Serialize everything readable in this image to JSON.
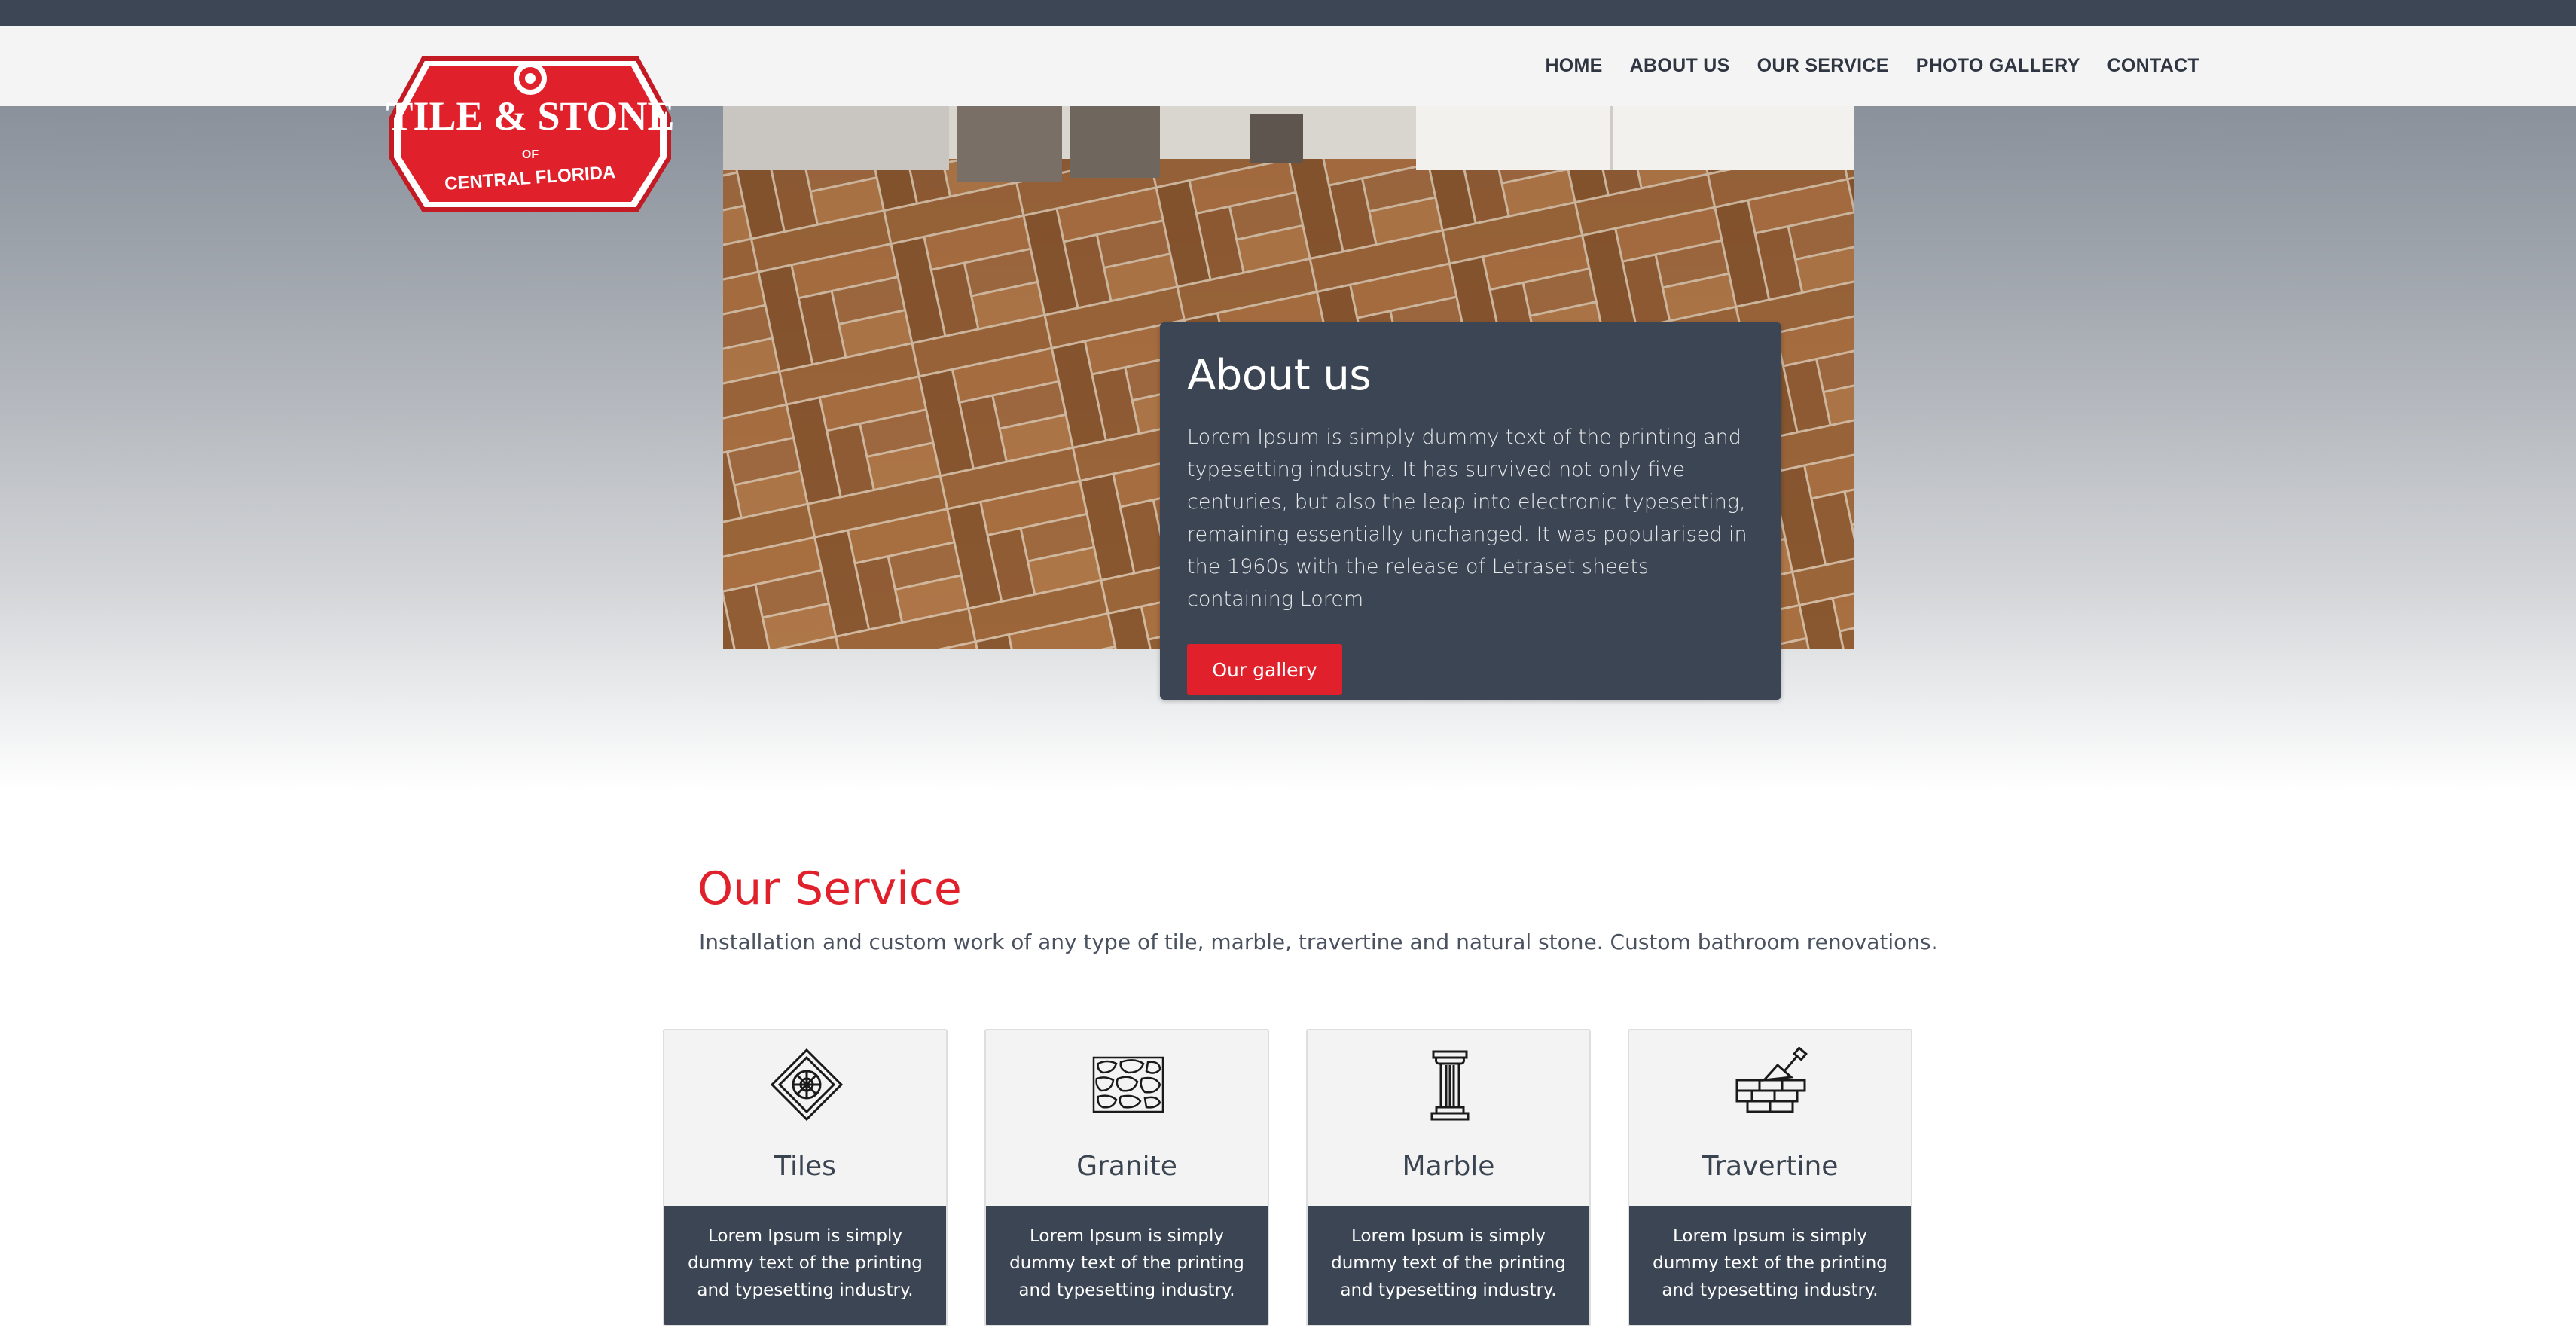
{
  "nav": {
    "items": [
      "HOME",
      "ABOUT US",
      "OUR SERVICE",
      "PHOTO GALLERY",
      "CONTACT"
    ]
  },
  "logo": {
    "line1": "TILE & STONE",
    "line2": "OF",
    "line3": "CENTRAL FLORIDA"
  },
  "about": {
    "title": "About us",
    "text": "Lorem Ipsum is simply dummy text of the printing and typesetting industry. It has survived not only five centuries, but also the leap into electronic typesetting, remaining essentially unchanged. It was popularised in the 1960s with the release of Letraset sheets containing Lorem",
    "button": "Our gallery"
  },
  "service": {
    "title": "Our Service",
    "subtitle": "Installation and custom work of any type of tile, marble, travertine and natural stone. Custom bathroom renovations.",
    "cards": [
      {
        "name": "Tiles",
        "icon": "tile-icon",
        "desc": "Lorem Ipsum is simply dummy text of the printing and typesetting industry."
      },
      {
        "name": "Granite",
        "icon": "granite-icon",
        "desc": "Lorem Ipsum is simply dummy text of the printing and typesetting industry."
      },
      {
        "name": "Marble",
        "icon": "column-icon",
        "desc": "Lorem Ipsum is simply dummy text of the printing and typesetting industry."
      },
      {
        "name": "Travertine",
        "icon": "brick-trowel-icon",
        "desc": "Lorem Ipsum is simply dummy text of the printing and typesetting industry."
      }
    ]
  },
  "colors": {
    "accent": "#e0202b",
    "dark": "#3c4553",
    "header": "#f4f4f4"
  }
}
